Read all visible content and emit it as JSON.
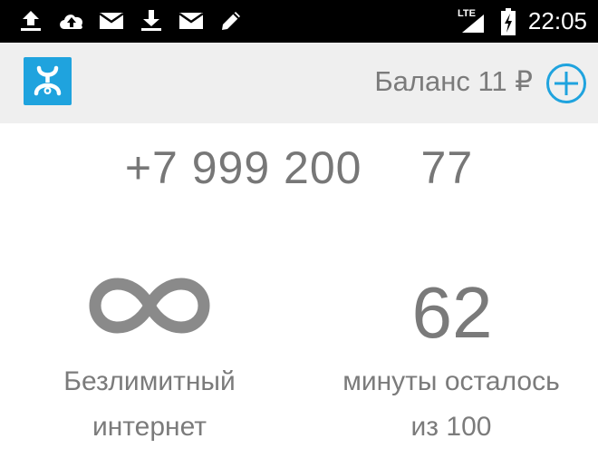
{
  "status_bar": {
    "left_icons": [
      "upload-icon",
      "cloud-upload-icon",
      "mail-icon",
      "download-icon",
      "mail-icon",
      "pencil-icon"
    ],
    "network_label": "LTE",
    "signal_icon": "signal-icon",
    "battery_icon": "battery-charging-icon",
    "time": "22:05"
  },
  "app_bar": {
    "logo_icon": "yota-logo-icon",
    "balance_text": "Баланс 11 ₽",
    "add_icon": "plus-circle-icon",
    "accent_color": "#1fa3de"
  },
  "account": {
    "phone_number": "+7 999 200 ·· 77"
  },
  "tariff": {
    "internet": {
      "icon": "infinity-icon",
      "label_line1": "Безлимитный",
      "label_line2": "интернет"
    },
    "minutes": {
      "remaining": "62",
      "label_line1": "минуты осталось",
      "label_line2": "из 100"
    }
  }
}
